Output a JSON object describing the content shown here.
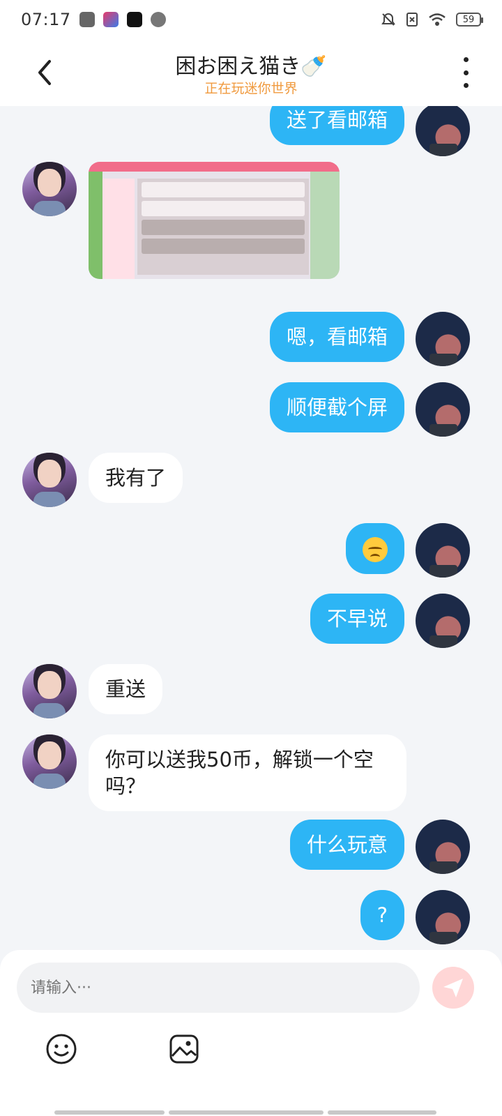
{
  "status_bar": {
    "time": "07:17",
    "battery": "59"
  },
  "header": {
    "title": "困お困え猫き🍼",
    "subtitle": "正在玩迷你世界"
  },
  "messages": [
    {
      "side": "me",
      "text": "送了看邮箱"
    },
    {
      "side": "them",
      "type": "image"
    },
    {
      "side": "me",
      "text": "嗯，看邮箱"
    },
    {
      "side": "me",
      "text": "顺便截个屏"
    },
    {
      "side": "them",
      "text": "我有了"
    },
    {
      "side": "me",
      "text": "😓"
    },
    {
      "side": "me",
      "text": "不早说"
    },
    {
      "side": "them",
      "text": "重送"
    },
    {
      "side": "them",
      "text": "你可以送我50币，解锁一个空吗？"
    },
    {
      "side": "me",
      "text": "什么玩意"
    },
    {
      "side": "me",
      "text": "?"
    }
  ],
  "input": {
    "placeholder": "请输入···"
  },
  "colors": {
    "my_bubble": "#2db5f5",
    "their_bubble": "#ffffff",
    "subtitle": "#f09a3e",
    "send": "#ffd6d6"
  },
  "icons": [
    "back-icon",
    "more-icon",
    "emoji-icon",
    "image-icon",
    "send-icon"
  ]
}
